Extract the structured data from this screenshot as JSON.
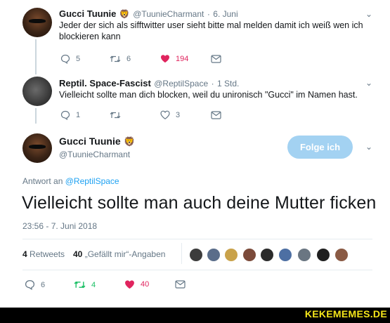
{
  "tweet1": {
    "name": "Gucci Tuunie",
    "emoji": "🦁",
    "handle": "@TuunieCharmant",
    "sep": "·",
    "date": "6. Juni",
    "text": "Jeder der sich als sifftwitter user sieht bitte mal melden damit ich weiß wen ich blockieren kann",
    "replies": "5",
    "retweets": "6",
    "likes": "194"
  },
  "tweet2": {
    "name": "Reptil. Space-Fascist",
    "handle": "@ReptilSpace",
    "sep": "·",
    "date": "1 Std.",
    "text": "Vielleicht sollte man dich blocken, weil du unironisch \"Gucci\" im Namen hast.",
    "replies": "1",
    "retweets": "",
    "likes": "3"
  },
  "main": {
    "name": "Gucci Tuunie",
    "emoji": "🦁",
    "handle": "@TuunieCharmant",
    "follow_label": "Folge ich",
    "reply_to_prefix": "Antwort an",
    "reply_to_handle": "@ReptilSpace",
    "text": "Vielleicht sollte man auch deine Mutter ficken",
    "timestamp": "23:56 - 7. Juni 2018",
    "retweets_count": "4",
    "retweets_label": "Retweets",
    "likes_count": "40",
    "likes_label": "„Gefällt mir“-Angaben",
    "replies": "6",
    "retweets": "4",
    "likes": "40"
  },
  "watermark": "KEKEMEMES.DE",
  "colors": {
    "retweet_green": "#17bf63",
    "like_red": "#e0245e",
    "link_blue": "#1da1f2",
    "follow_bg": "#a3d2f2",
    "muted": "#657786"
  },
  "icons": [
    "reply-icon",
    "retweet-icon",
    "heart-icon",
    "message-icon",
    "chevron-down-icon"
  ]
}
